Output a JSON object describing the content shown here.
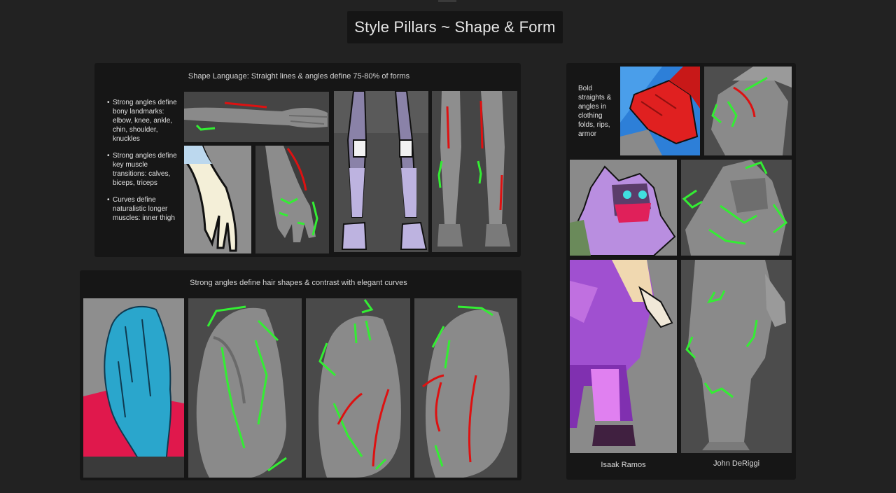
{
  "page": {
    "title": "Style Pillars ~ Shape & Form"
  },
  "shape_language": {
    "caption": "Shape Language: Straight lines & angles define 75-80% of forms",
    "bullets": [
      "Strong angles define bony landmarks: elbow, knee, ankle, chin, shoulder, knuckles",
      "Strong angles define key muscle transitions: calves, biceps, triceps",
      "Curves define naturalistic longer muscles: inner thigh"
    ]
  },
  "hair": {
    "caption": "Strong angles define hair shapes & contrast with elegant curves"
  },
  "clothing": {
    "note": "Bold straights & angles in clothing folds, rips, armor",
    "artists": [
      "Isaak Ramos",
      "John DeRiggi"
    ]
  },
  "colors": {
    "background": "#222222",
    "panel": "#161616",
    "guide_green": "#33ee33",
    "guide_red": "#dd1111"
  }
}
